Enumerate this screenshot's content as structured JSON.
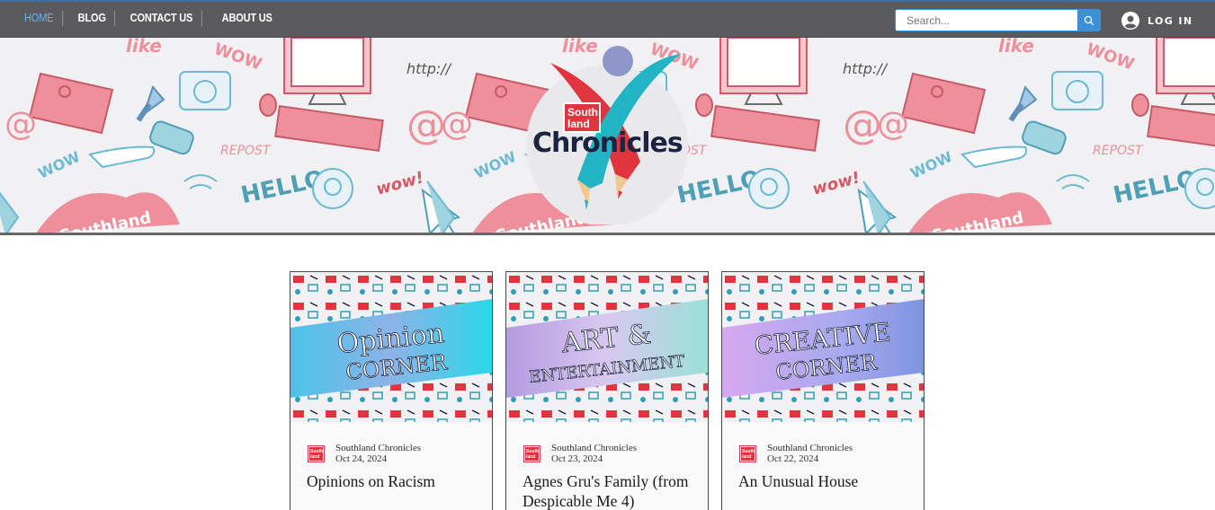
{
  "nav": {
    "items": [
      {
        "label": "HOME",
        "active": true
      },
      {
        "label": "BLOG",
        "active": false
      },
      {
        "label": "CONTACT US",
        "active": false
      },
      {
        "label": "ABOUT US",
        "active": false
      }
    ]
  },
  "search": {
    "placeholder": "Search..."
  },
  "login": {
    "label": "LOG IN"
  },
  "banner": {
    "brand_tag": "South land",
    "brand_name": "Chronicles"
  },
  "posts": [
    {
      "banner_line1": "Opinion",
      "banner_line2": "corner",
      "author": "Southland Chronicles",
      "date": "Oct 24, 2024",
      "title": "Opinions on Racism"
    },
    {
      "banner_line1": "Art &",
      "banner_line2": "Entertainment",
      "author": "Southland Chronicles",
      "date": "Oct 23, 2024",
      "title": "Agnes Gru's Family (from Despicable Me 4)"
    },
    {
      "banner_line1": "Creative",
      "banner_line2": "corner",
      "author": "Southland Chronicles",
      "date": "Oct 22, 2024",
      "title": "An Unusual House"
    }
  ],
  "colors": {
    "nav_bg": "#5b5a5c",
    "nav_active": "#6fb2ee",
    "search_btn": "#3a8fd6",
    "brand_red": "#e0353f",
    "brand_navy": "#1c2340"
  }
}
